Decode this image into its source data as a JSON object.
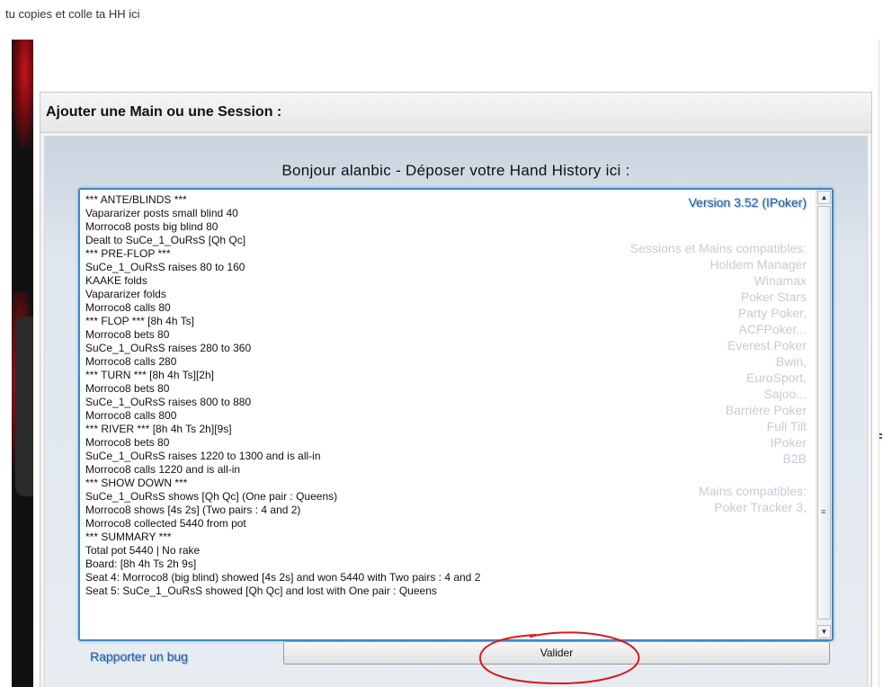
{
  "intro_text": "tu copies et colle ta HH ici",
  "panel": {
    "title": "Ajouter une Main ou une Session :",
    "greeting": "Bonjour alanbic - Déposer votre Hand History ici :"
  },
  "hand_history": {
    "lines": [
      "*** ANTE/BLINDS ***",
      "Vapararizer posts small blind 40",
      "Morroco8 posts big blind 80",
      "Dealt to SuCe_1_OuRsS [Qh Qc]",
      "*** PRE-FLOP ***",
      "SuCe_1_OuRsS raises 80 to 160",
      "KAAKE folds",
      "Vapararizer folds",
      "Morroco8 calls 80",
      "*** FLOP *** [8h 4h Ts]",
      "Morroco8 bets 80",
      "SuCe_1_OuRsS raises 280 to 360",
      "Morroco8 calls 280",
      "*** TURN *** [8h 4h Ts][2h]",
      "Morroco8 bets 80",
      "SuCe_1_OuRsS raises 800 to 880",
      "Morroco8 calls 800",
      "*** RIVER *** [8h 4h Ts 2h][9s]",
      "Morroco8 bets 80",
      "SuCe_1_OuRsS raises 1220 to 1300 and is all-in",
      "Morroco8 calls 1220 and is all-in",
      "*** SHOW DOWN ***",
      "SuCe_1_OuRsS shows [Qh Qc] (One pair : Queens)",
      "Morroco8 shows [4s 2s] (Two pairs : 4 and 2)",
      "Morroco8 collected 5440 from pot",
      "*** SUMMARY ***",
      "Total pot 5440 | No rake",
      "Board: [8h 4h Ts 2h 9s]",
      "Seat 4: Morroco8 (big blind) showed [4s 2s] and won 5440 with Two pairs : 4 and 2",
      "Seat 5: SuCe_1_OuRsS showed [Qh Qc] and lost with One pair : Queens"
    ],
    "version_label": "Version 3.52 (IPoker)",
    "compat_lines": [
      "Sessions et Mains compatibles:",
      "Holdem Manager",
      "Winamax",
      "Poker Stars",
      "Party Poker,",
      "ACFPoker...",
      "Everest Poker",
      "Bwin,",
      "EuroSport,",
      "Sajoo...",
      "Barrière Poker",
      "Full Tilt",
      "IPoker",
      "B2B",
      "",
      "Mains compatibles:",
      "Poker Tracker 3,"
    ]
  },
  "actions": {
    "bug_link": "Rapporter un bug",
    "submit_label": "Valider"
  },
  "icons": {
    "scroll_up": "arrow-up-icon",
    "scroll_down": "arrow-down-icon",
    "grip": "scroll-grip-icon"
  },
  "colors": {
    "link": "#1f5fa8",
    "focus_border": "#3f86c8",
    "compat_text": "#c4ccd6",
    "annotation": "#d9191c"
  }
}
